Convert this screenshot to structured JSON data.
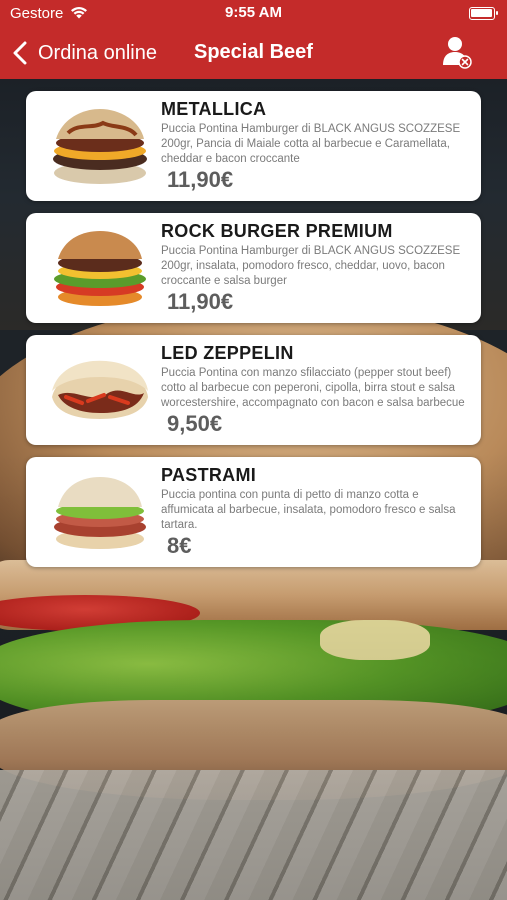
{
  "status_bar": {
    "carrier": "Gestore",
    "time": "9:55 AM"
  },
  "nav": {
    "back_label": "Ordina online",
    "title": "Special Beef",
    "back_icon": "chevron-left-icon",
    "user_icon": "user-remove-icon"
  },
  "colors": {
    "header": "#c42b2a",
    "price": "#5d5d5d",
    "card": "#ffffff"
  },
  "products": [
    {
      "name": "METALLICA",
      "description": "Puccia Pontina Hamburger di BLACK ANGUS SCOZZESE 200gr, Pancia di Maiale cotta al barbecue e Caramellata, cheddar e bacon croccante",
      "price": "11,90€",
      "image": "burger-metallica-image"
    },
    {
      "name": "ROCK BURGER PREMIUM",
      "description": "Puccia Pontina Hamburger di BLACK ANGUS SCOZZESE 200gr, insalata, pomodoro fresco, cheddar, uovo, bacon croccante e salsa burger",
      "price": "11,90€",
      "image": "burger-rock-premium-image"
    },
    {
      "name": "LED ZEPPELIN",
      "description": "Puccia Pontina con manzo sfilacciato (pepper stout beef) cotto al barbecue con peperoni, cipolla, birra stout e salsa worcestershire, accompagnato con bacon e salsa barbecue",
      "price": "9,50€",
      "image": "sandwich-led-zeppelin-image"
    },
    {
      "name": "PASTRAMI",
      "description": "Puccia pontina con punta di petto di manzo cotta e affumicata al barbecue, insalata, pomodoro fresco e salsa tartara.",
      "price": "8€",
      "image": "sandwich-pastrami-image"
    }
  ]
}
